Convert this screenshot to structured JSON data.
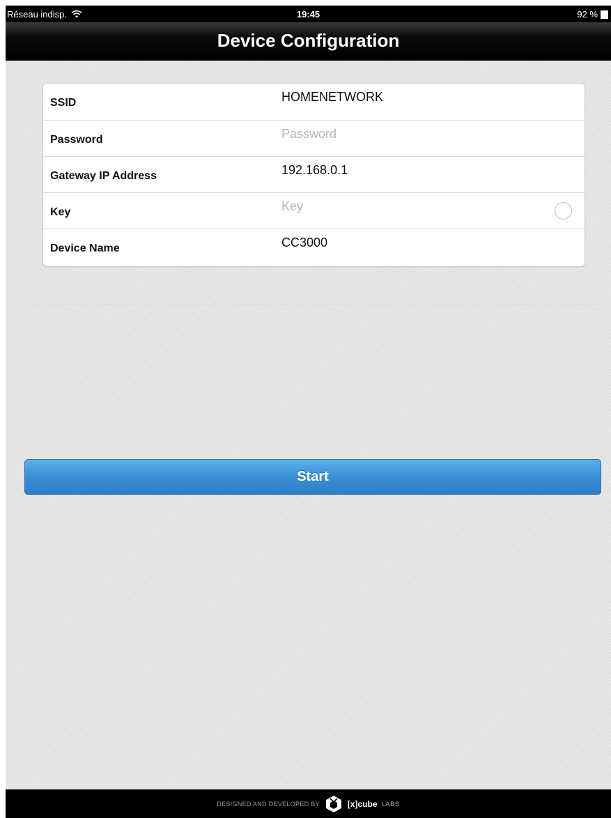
{
  "status_bar": {
    "carrier": "Réseau indisp.",
    "time": "19:45",
    "battery": "92 %"
  },
  "nav": {
    "title": "Device Configuration"
  },
  "form": {
    "rows": [
      {
        "label": "SSID",
        "value": "HOMENETWORK",
        "placeholder": ""
      },
      {
        "label": "Password",
        "value": "",
        "placeholder": "Password"
      },
      {
        "label": "Gateway IP Address",
        "value": "192.168.0.1",
        "placeholder": ""
      },
      {
        "label": "Key",
        "value": "",
        "placeholder": "Key"
      },
      {
        "label": "Device Name",
        "value": "CC3000",
        "placeholder": ""
      }
    ]
  },
  "start_button": {
    "label": "Start"
  },
  "footer": {
    "credit": "DESIGNED AND DEVELOPED BY",
    "brand": "[x]cube",
    "brand_suffix": "LABS"
  },
  "colors": {
    "button_blue": "#3a8fd7",
    "nav_black": "#000000",
    "background_grey": "#e4e4e4"
  },
  "icons": {
    "wifi": "wifi-icon",
    "battery": "battery-icon",
    "key_toggle": "radio-circle",
    "logo": "xcube-logo-icon"
  }
}
